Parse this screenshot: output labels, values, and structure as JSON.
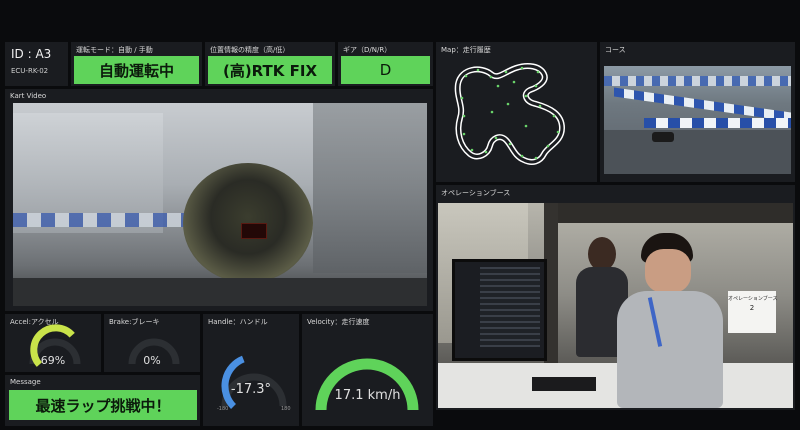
{
  "vehicle": {
    "id": "ID : A3",
    "ecu": "ECU-RK-02"
  },
  "driving_mode": {
    "label": "運転モード：自動 / 手動",
    "value": "自動運転中"
  },
  "position_accuracy": {
    "label": "位置情報の精度（高/低）",
    "value": "(高)RTK FIX"
  },
  "gear": {
    "label": "ギア（D/N/R）",
    "value": "D"
  },
  "map": {
    "label": "Map：走行履歴"
  },
  "course": {
    "label": "コース"
  },
  "kart_video": {
    "label": "Kart Video"
  },
  "operation_booth": {
    "label": "オペレーションブース",
    "sign_title": "オペレーションブース",
    "sign_number": "2"
  },
  "accel": {
    "label": "Accel:アクセル",
    "value": "69%",
    "level": 0.69
  },
  "brake": {
    "label": "Brake:ブレーキ",
    "value": "0%",
    "level": 0
  },
  "handle": {
    "label": "Handle：ハンドル",
    "value": "-17.3°",
    "level": 0.42
  },
  "velocity": {
    "label": "Velocity：走行速度",
    "value": "17.1 km/h",
    "level": 0.6
  },
  "message": {
    "label": "Message",
    "value": "最速ラップ挑戦中！"
  },
  "colors": {
    "accent_green": "#5fd35a",
    "gauge_yellow": "#c9e34a",
    "gauge_blue": "#4a90e2",
    "panel_bg": "#1a1c20"
  }
}
